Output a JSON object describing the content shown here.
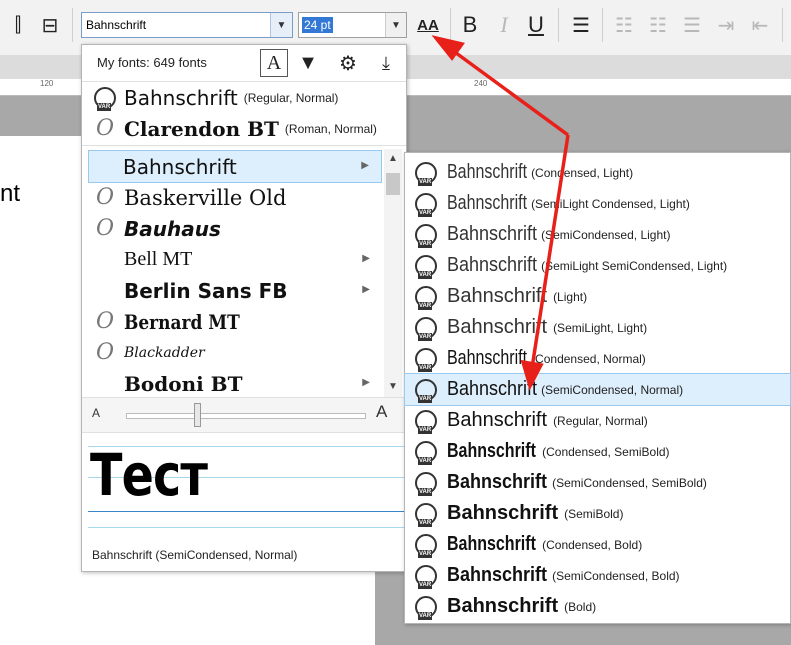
{
  "toolbar": {
    "font_value": "Bahnschrift",
    "size_value": "24 pt",
    "font_size_icon": "AA",
    "bold": "B",
    "italic": "I",
    "underline": "U"
  },
  "ruler": {
    "marks": [
      "120",
      "240"
    ]
  },
  "document": {
    "visible_text": "nt"
  },
  "font_panel": {
    "fonts_count": "My fonts: 649 fonts",
    "recent": [
      {
        "name": "Bahnschrift",
        "style": "(Regular, Normal)",
        "icon": "var-font-icon"
      },
      {
        "name": "Clarendon BT",
        "style": "(Roman, Normal)",
        "icon": "opentype-icon"
      }
    ],
    "list": [
      {
        "name": "Bahnschrift",
        "icon": "none",
        "submenu": true,
        "selected": true
      },
      {
        "name": "Baskerville Old",
        "icon": "opentype-icon",
        "submenu": false
      },
      {
        "name": "Bauhaus",
        "icon": "opentype-icon",
        "submenu": false
      },
      {
        "name": "Bell MT",
        "icon": "none",
        "submenu": true
      },
      {
        "name": "Berlin Sans FB",
        "icon": "none",
        "submenu": true
      },
      {
        "name": "Bernard MT",
        "icon": "opentype-icon",
        "submenu": false
      },
      {
        "name": "Blackadder",
        "icon": "opentype-icon",
        "submenu": false
      },
      {
        "name": "Bodoni BT",
        "icon": "none",
        "submenu": true
      }
    ],
    "zoom_small": "A",
    "zoom_large": "A",
    "zoom_level": 0.3,
    "preview_text": "Тест",
    "status": "Bahnschrift (SemiCondensed, Normal)"
  },
  "submenu": {
    "family": "Bahnschrift",
    "items": [
      {
        "style": "(Condensed, Light)"
      },
      {
        "style": "(SemiLight Condensed, Light)"
      },
      {
        "style": "(SemiCondensed, Light)"
      },
      {
        "style": "(SemiLight SemiCondensed, Light)"
      },
      {
        "style": "(Light)"
      },
      {
        "style": "(SemiLight, Light)"
      },
      {
        "style": "(Condensed, Normal)"
      },
      {
        "style": "(SemiCondensed, Normal)",
        "selected": true
      },
      {
        "style": "(Regular, Normal)"
      },
      {
        "style": "(Condensed, SemiBold)"
      },
      {
        "style": "(SemiCondensed, SemiBold)"
      },
      {
        "style": "(SemiBold)"
      },
      {
        "style": "(Condensed, Bold)"
      },
      {
        "style": "(SemiCondensed, Bold)"
      },
      {
        "style": "(Bold)"
      }
    ]
  },
  "colors": {
    "accent": "#3478d6",
    "highlight": "#ddeefc",
    "annotation_arrow": "#e8201a"
  }
}
